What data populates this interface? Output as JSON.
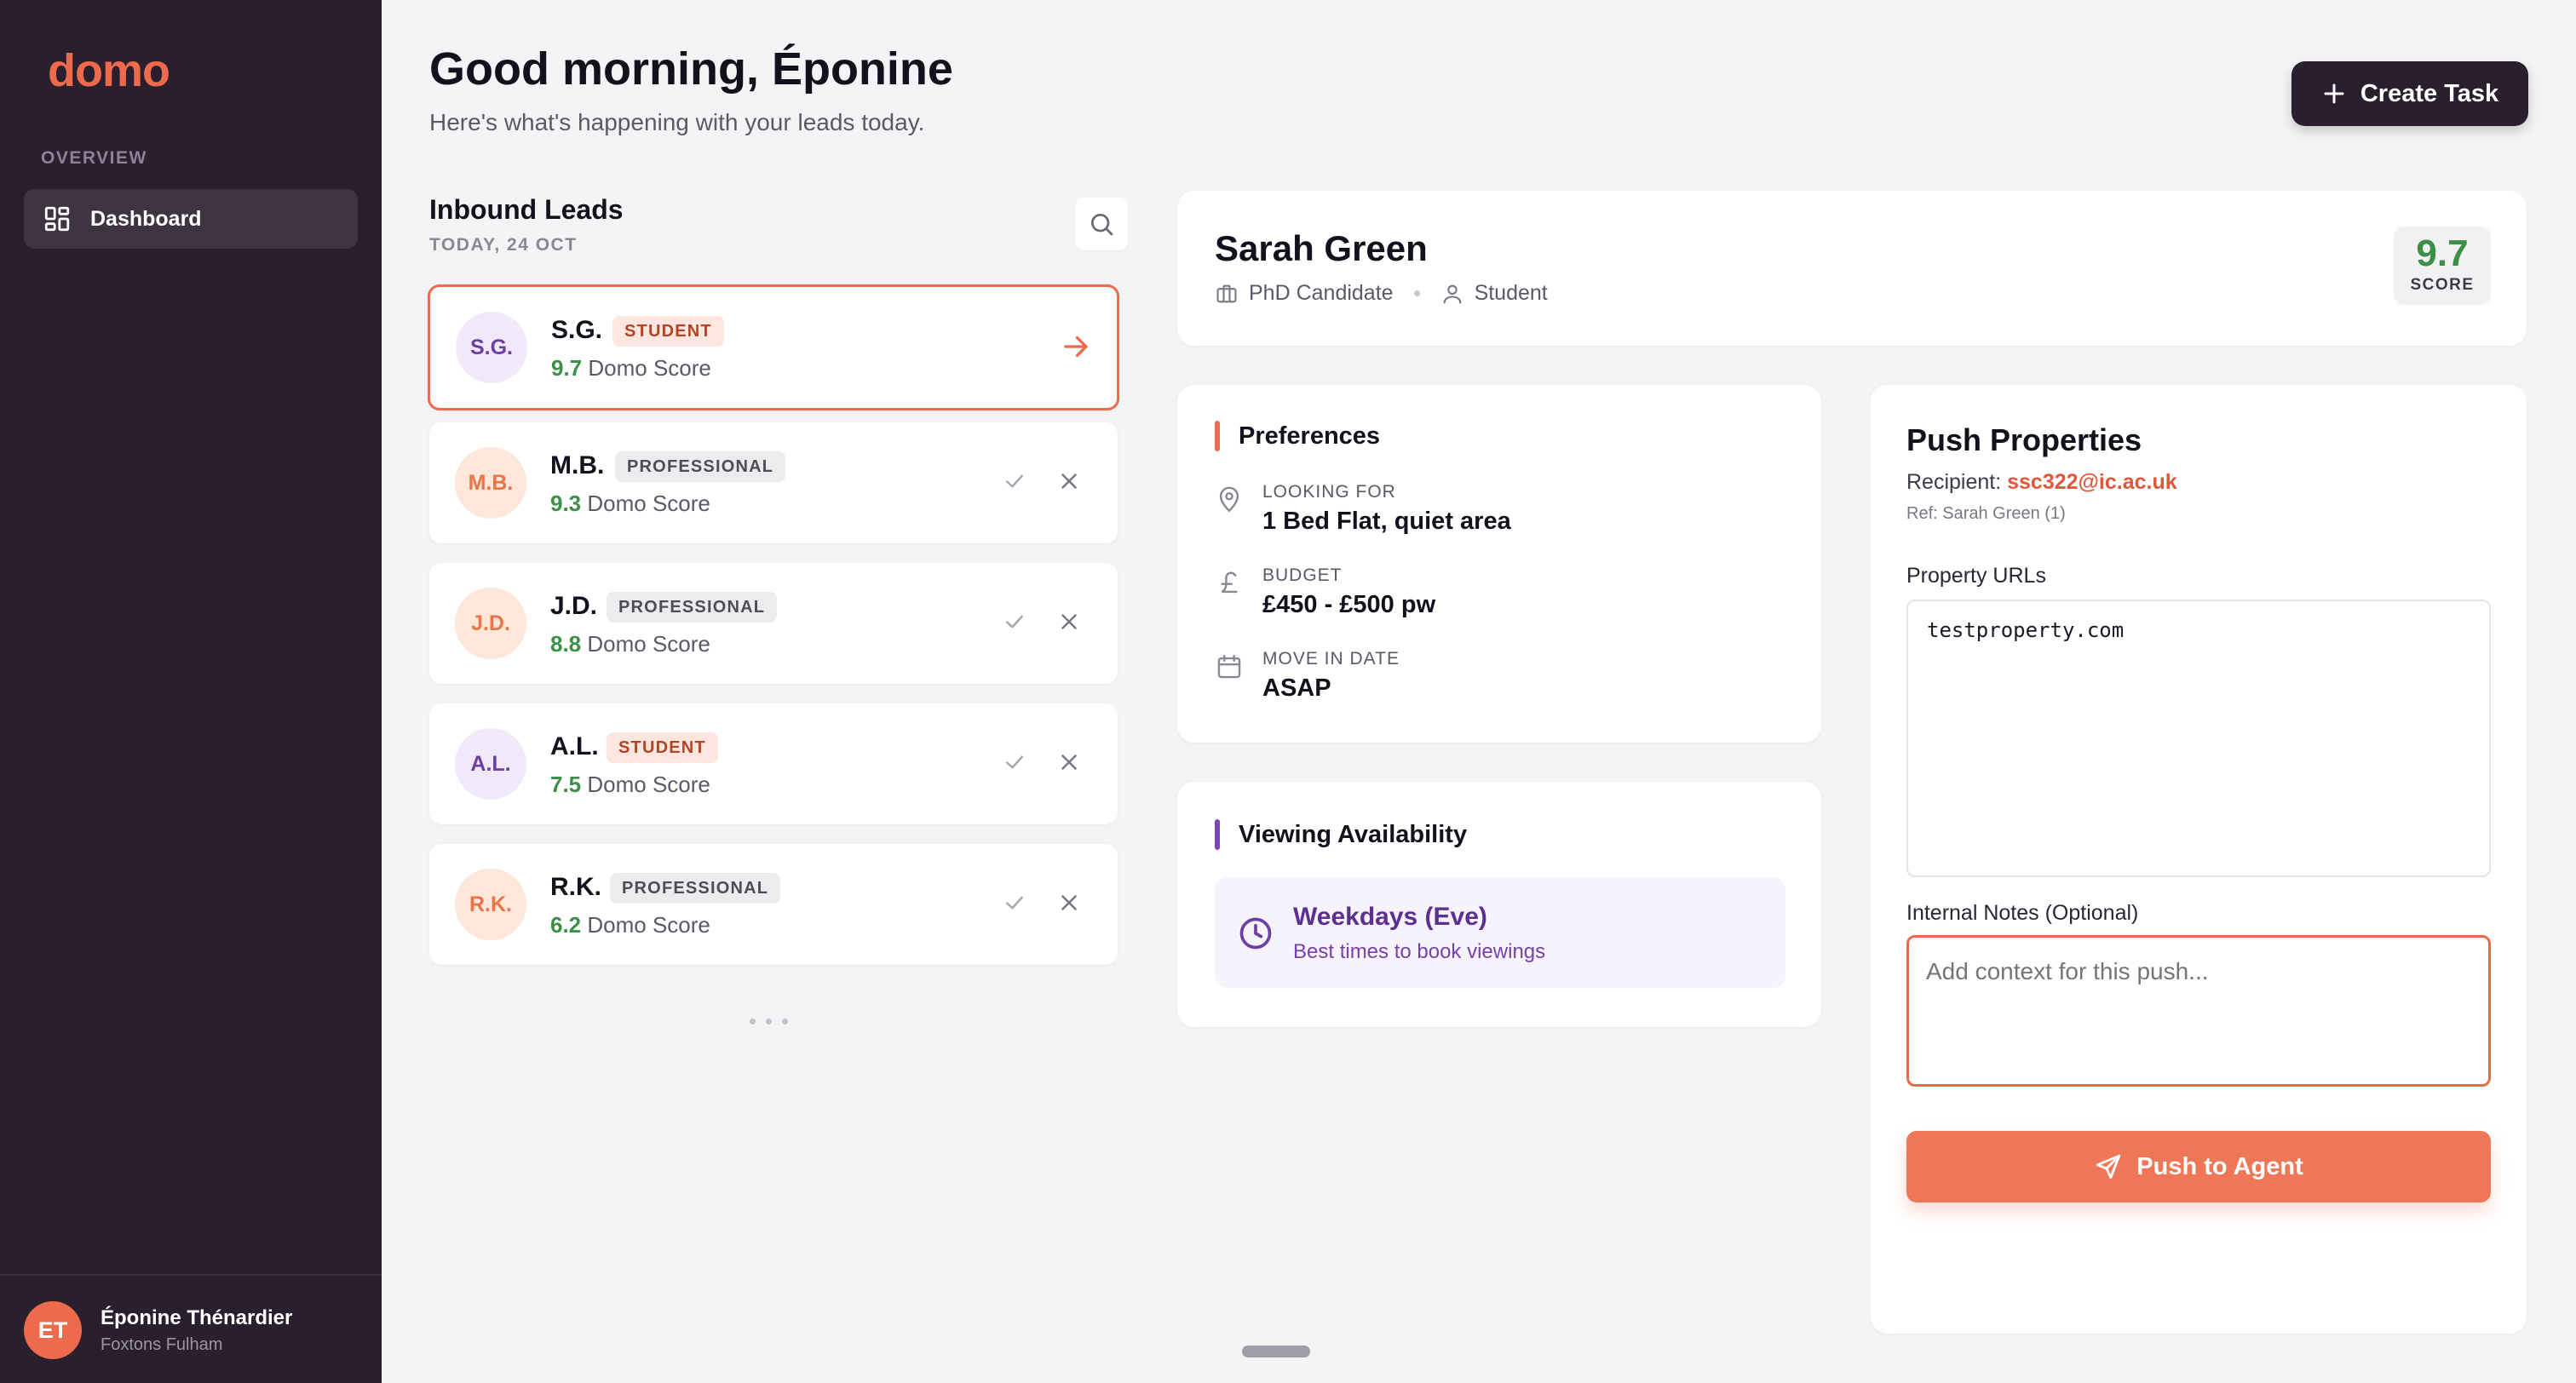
{
  "app": {
    "logo": "domo"
  },
  "sidebar": {
    "section_label": "OVERVIEW",
    "items": [
      {
        "label": "Dashboard",
        "icon": "dashboard-grid-icon",
        "active": true
      }
    ],
    "user": {
      "initials": "ET",
      "name": "Éponine Thénardier",
      "org": "Foxtons Fulham"
    }
  },
  "header": {
    "greeting": "Good morning, Éponine",
    "subtitle": "Here's what's happening with your leads today.",
    "create_button": "Create Task"
  },
  "leads": {
    "title": "Inbound Leads",
    "date": "TODAY, 24 OCT",
    "score_suffix": "Domo Score",
    "items": [
      {
        "initials": "S.G.",
        "tag": "STUDENT",
        "score": "9.7",
        "avatar_color": "purple",
        "active": true
      },
      {
        "initials": "M.B.",
        "tag": "PROFESSIONAL",
        "score": "9.3",
        "avatar_color": "orange",
        "active": false
      },
      {
        "initials": "J.D.",
        "tag": "PROFESSIONAL",
        "score": "8.8",
        "avatar_color": "orange",
        "active": false
      },
      {
        "initials": "A.L.",
        "tag": "STUDENT",
        "score": "7.5",
        "avatar_color": "purple",
        "active": false
      },
      {
        "initials": "R.K.",
        "tag": "PROFESSIONAL",
        "score": "6.2",
        "avatar_color": "orange",
        "active": false
      }
    ]
  },
  "profile": {
    "name": "Sarah Green",
    "occupation": "PhD Candidate",
    "type": "Student",
    "score": "9.7",
    "score_label": "SCORE"
  },
  "preferences": {
    "title": "Preferences",
    "looking_for_label": "LOOKING FOR",
    "looking_for": "1 Bed Flat, quiet area",
    "budget_label": "BUDGET",
    "budget": "£450 - £500 pw",
    "move_in_label": "MOVE IN DATE",
    "move_in": "ASAP"
  },
  "viewing": {
    "title": "Viewing Availability",
    "slot": "Weekdays (Eve)",
    "note": "Best times to book viewings"
  },
  "push": {
    "title": "Push Properties",
    "recipient_label": "Recipient:",
    "recipient_email": "ssc322@ic.ac.uk",
    "ref": "Ref: Sarah Green (1)",
    "urls_label": "Property URLs",
    "urls_value": "testproperty.com",
    "notes_label": "Internal Notes (Optional)",
    "notes_placeholder": "Add context for this push...",
    "button": "Push to Agent"
  },
  "colors": {
    "brand": "#ee6a4c",
    "sidebar_bg": "#2a1f2e",
    "score_green": "#3b8f46",
    "accent_purple": "#6d3fa3"
  }
}
